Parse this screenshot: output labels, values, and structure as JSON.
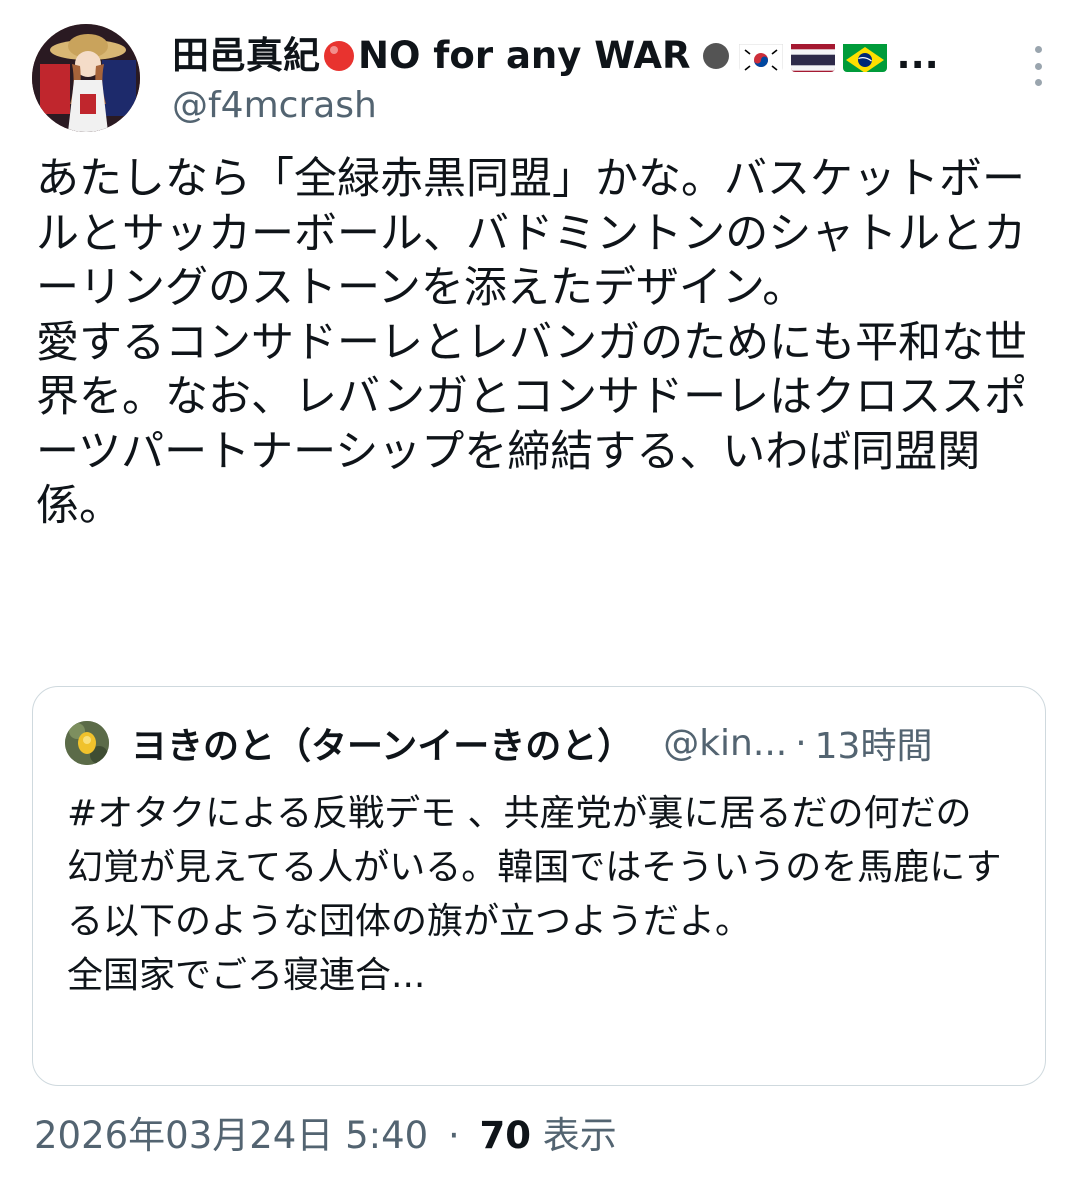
{
  "author": {
    "display_name_part1": "田邑真紀",
    "display_name_part2": "NO for any WAR",
    "display_name_ellipsis": "...",
    "handle": "@f4mcrash",
    "flags": [
      "korea-flag",
      "thailand-flag",
      "brazil-flag"
    ],
    "avatar_icon": "anime-character-avatar"
  },
  "tweet": {
    "text": "あたしなら「全緑赤黒同盟」かな。バスケットボールとサッカーボール、バドミントンのシャトルとカーリングのストーンを添えたデザイン。\n愛するコンサドーレとレバンガのためにも平和な世界を。なお、レバンガとコンサドーレはクロススポーツパートナーシップを締結する、いわば同盟関係。"
  },
  "quote": {
    "display_name": "ヨきのと（ターンイーきのと）",
    "handle": "@kin...",
    "separator": "·",
    "time": "13時間",
    "text": "#オタクによる反戦デモ 、共産党が裏に居るだの何だの幻覚が見えてる人がいる。韓国ではそういうのを馬鹿にする以下のような団体の旗が立つようだよ。\n全国家でごろ寝連合..."
  },
  "footer": {
    "timestamp": "2026年03月24日 5:40",
    "separator": "·",
    "views_count": "70",
    "views_label": "表示"
  },
  "colors": {
    "text_primary": "#0f1419",
    "text_secondary": "#536471",
    "border": "#cfd9de",
    "red_dot": "#e8332f",
    "gray_dot": "#545454"
  }
}
